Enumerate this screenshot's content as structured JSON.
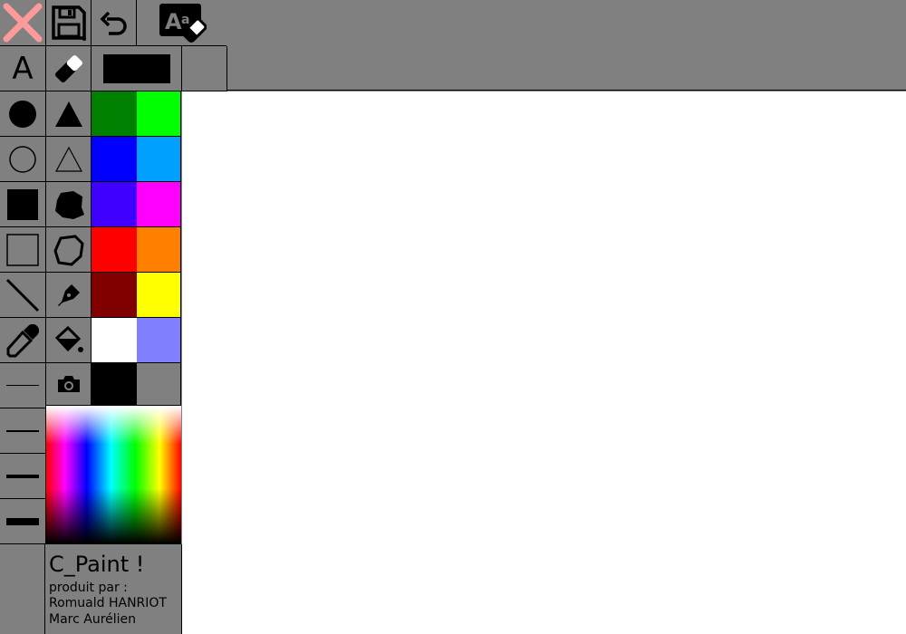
{
  "toolbar": {
    "close": {
      "icon": "close-icon"
    },
    "save": {
      "icon": "floppy-disk-icon"
    },
    "undo": {
      "icon": "undo-icon"
    },
    "erase_text": {
      "icon": "text-eraser-icon",
      "label": "A"
    },
    "text_tool": {
      "icon": "text-tool-icon",
      "label": "A"
    },
    "eraser": {
      "icon": "eraser-icon"
    },
    "current_color": "#000000"
  },
  "tools": [
    {
      "name": "filled-circle-icon"
    },
    {
      "name": "filled-triangle-icon"
    },
    {
      "name": "outline-circle-icon"
    },
    {
      "name": "outline-triangle-icon"
    },
    {
      "name": "filled-square-icon"
    },
    {
      "name": "filled-polygon-icon"
    },
    {
      "name": "outline-square-icon"
    },
    {
      "name": "outline-polygon-icon"
    },
    {
      "name": "line-icon"
    },
    {
      "name": "pen-nib-icon"
    },
    {
      "name": "eyedropper-icon"
    },
    {
      "name": "paint-bucket-icon"
    },
    {
      "name": "camera-icon"
    }
  ],
  "line_widths": [
    1,
    2,
    4,
    8
  ],
  "palette": [
    "#008000",
    "#00ff00",
    "#0000ff",
    "#00a0ff",
    "#4000ff",
    "#ff00ff",
    "#ff0000",
    "#ff8000",
    "#800000",
    "#ffff00",
    "#ffffff",
    "#8080ff",
    "#000000",
    "#808080"
  ],
  "credits": {
    "title": "C_Paint !",
    "line1": "produit par :",
    "line2": "Romuald HANRIOT",
    "line3": "Marc Aurélien"
  }
}
